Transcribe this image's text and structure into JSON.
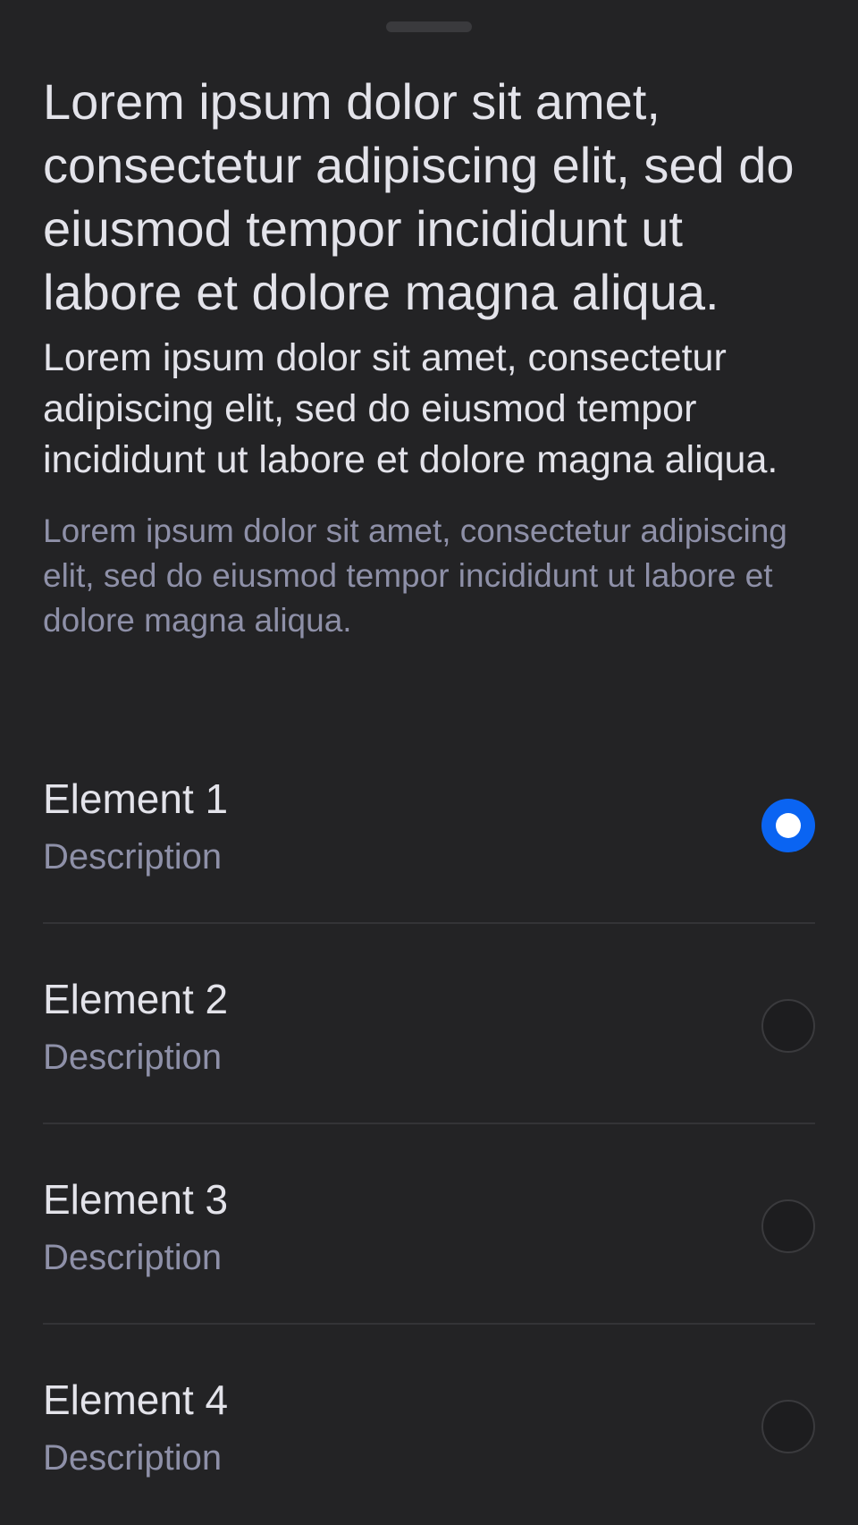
{
  "header": {
    "title": "Lorem ipsum dolor sit amet, consectetur adipiscing elit, sed do eiusmod tempor incididunt ut labore et dolore magna aliqua.",
    "subtitle": "Lorem ipsum dolor sit amet, consectetur adipiscing elit, sed do eiusmod tempor incididunt ut labore et dolore magna aliqua.",
    "caption": "Lorem ipsum dolor sit amet, consectetur adipiscing elit, sed do eiusmod tempor incididunt ut labore et dolore magna aliqua."
  },
  "options": [
    {
      "label": "Element 1",
      "description": "Description",
      "selected": true
    },
    {
      "label": "Element 2",
      "description": "Description",
      "selected": false
    },
    {
      "label": "Element 3",
      "description": "Description",
      "selected": false
    },
    {
      "label": "Element 4",
      "description": "Description",
      "selected": false
    }
  ],
  "colors": {
    "background": "#232325",
    "accent": "#0a64f2",
    "primary_text": "#e3e3ea",
    "secondary_text": "#8e90a8"
  }
}
